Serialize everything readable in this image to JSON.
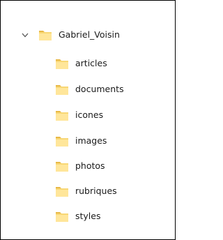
{
  "tree": {
    "root": {
      "label": "Gabriel_Voisin",
      "expanded_icon": "chevron-down-icon",
      "icon": "folder-icon"
    },
    "children": [
      {
        "label": "articles",
        "icon": "folder-icon"
      },
      {
        "label": "documents",
        "icon": "folder-icon"
      },
      {
        "label": "icones",
        "icon": "folder-icon"
      },
      {
        "label": "images",
        "icon": "folder-icon"
      },
      {
        "label": "photos",
        "icon": "folder-icon"
      },
      {
        "label": "rubriques",
        "icon": "folder-icon"
      },
      {
        "label": "styles",
        "icon": "folder-icon"
      }
    ]
  },
  "colors": {
    "folder_body": "#F8D775",
    "folder_front": "#FFE69A",
    "folder_tab": "#E8B845",
    "chevron": "#555555",
    "border": "#000000"
  }
}
